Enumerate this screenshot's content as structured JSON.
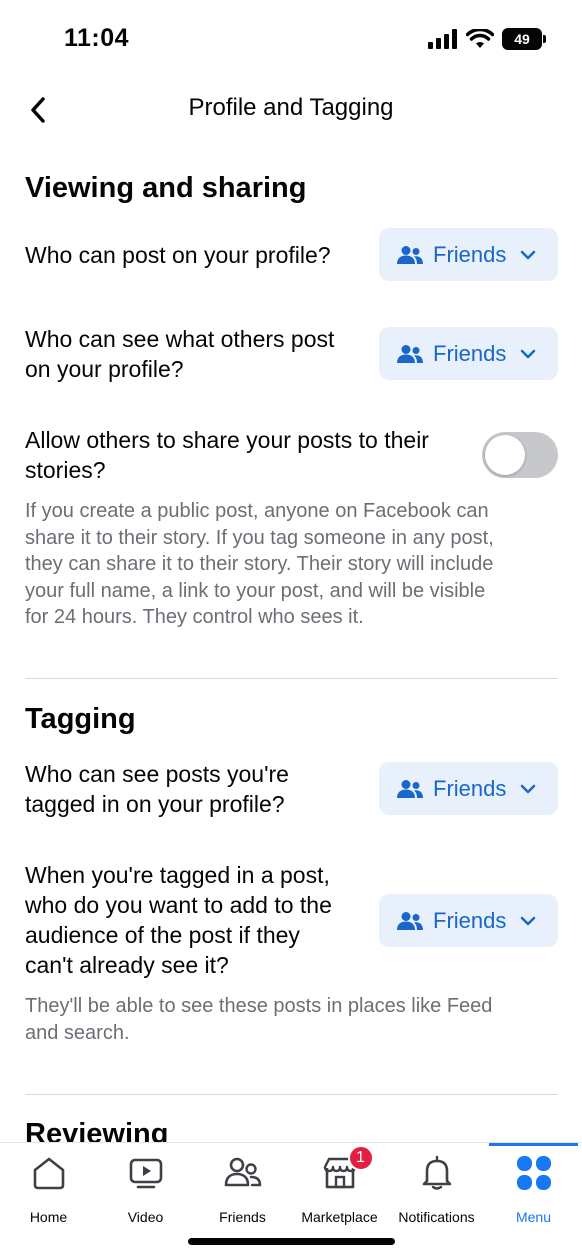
{
  "status_bar": {
    "time": "11:04",
    "battery": "49"
  },
  "header": {
    "title": "Profile and Tagging"
  },
  "viewing": {
    "title": "Viewing and sharing",
    "post_label": "Who can post on your profile?",
    "post_value": "Friends",
    "see_label_1": "Who can see what others post",
    "see_label_2": "on your profile?",
    "see_value": "Friends",
    "share_label_1": "Allow others to share your posts to their",
    "share_label_2": "stories?",
    "share_enabled": false,
    "help_lines": [
      "If you create a public post, anyone on Facebook can",
      "share it to their story. If you tag someone in any post,",
      "they can share it to their story. Their story will include",
      "your full name, a link to your post, and will be visible",
      "for 24 hours. They control who sees it."
    ]
  },
  "tagging": {
    "title": "Tagging",
    "tagged_label_1": "Who can see posts you're",
    "tagged_label_2": "tagged in on your profile?",
    "tagged_value": "Friends",
    "audience_lines": [
      "When you're tagged in a post,",
      "who do you want to add to the",
      "audience of the post if they",
      "can't already see it?"
    ],
    "audience_value": "Friends",
    "help_lines": [
      "They'll be able to see these posts in places like Feed",
      "and search."
    ]
  },
  "reviewing": {
    "title": "Reviewing"
  },
  "tab_bar": {
    "tabs": [
      {
        "label": "Home",
        "icon": "home-icon"
      },
      {
        "label": "Video",
        "icon": "video-icon"
      },
      {
        "label": "Friends",
        "icon": "friends-icon"
      },
      {
        "label": "Marketplace",
        "icon": "marketplace-icon",
        "badge": "1"
      },
      {
        "label": "Notifications",
        "icon": "bell-icon"
      },
      {
        "label": "Menu",
        "icon": "menu-icon",
        "active": true
      }
    ]
  },
  "colors": {
    "accent": "#1877f2",
    "button_bg": "#e7f0fb",
    "button_text": "#1a66c9",
    "badge": "#e41e3f",
    "muted_text": "#6b6f75"
  }
}
